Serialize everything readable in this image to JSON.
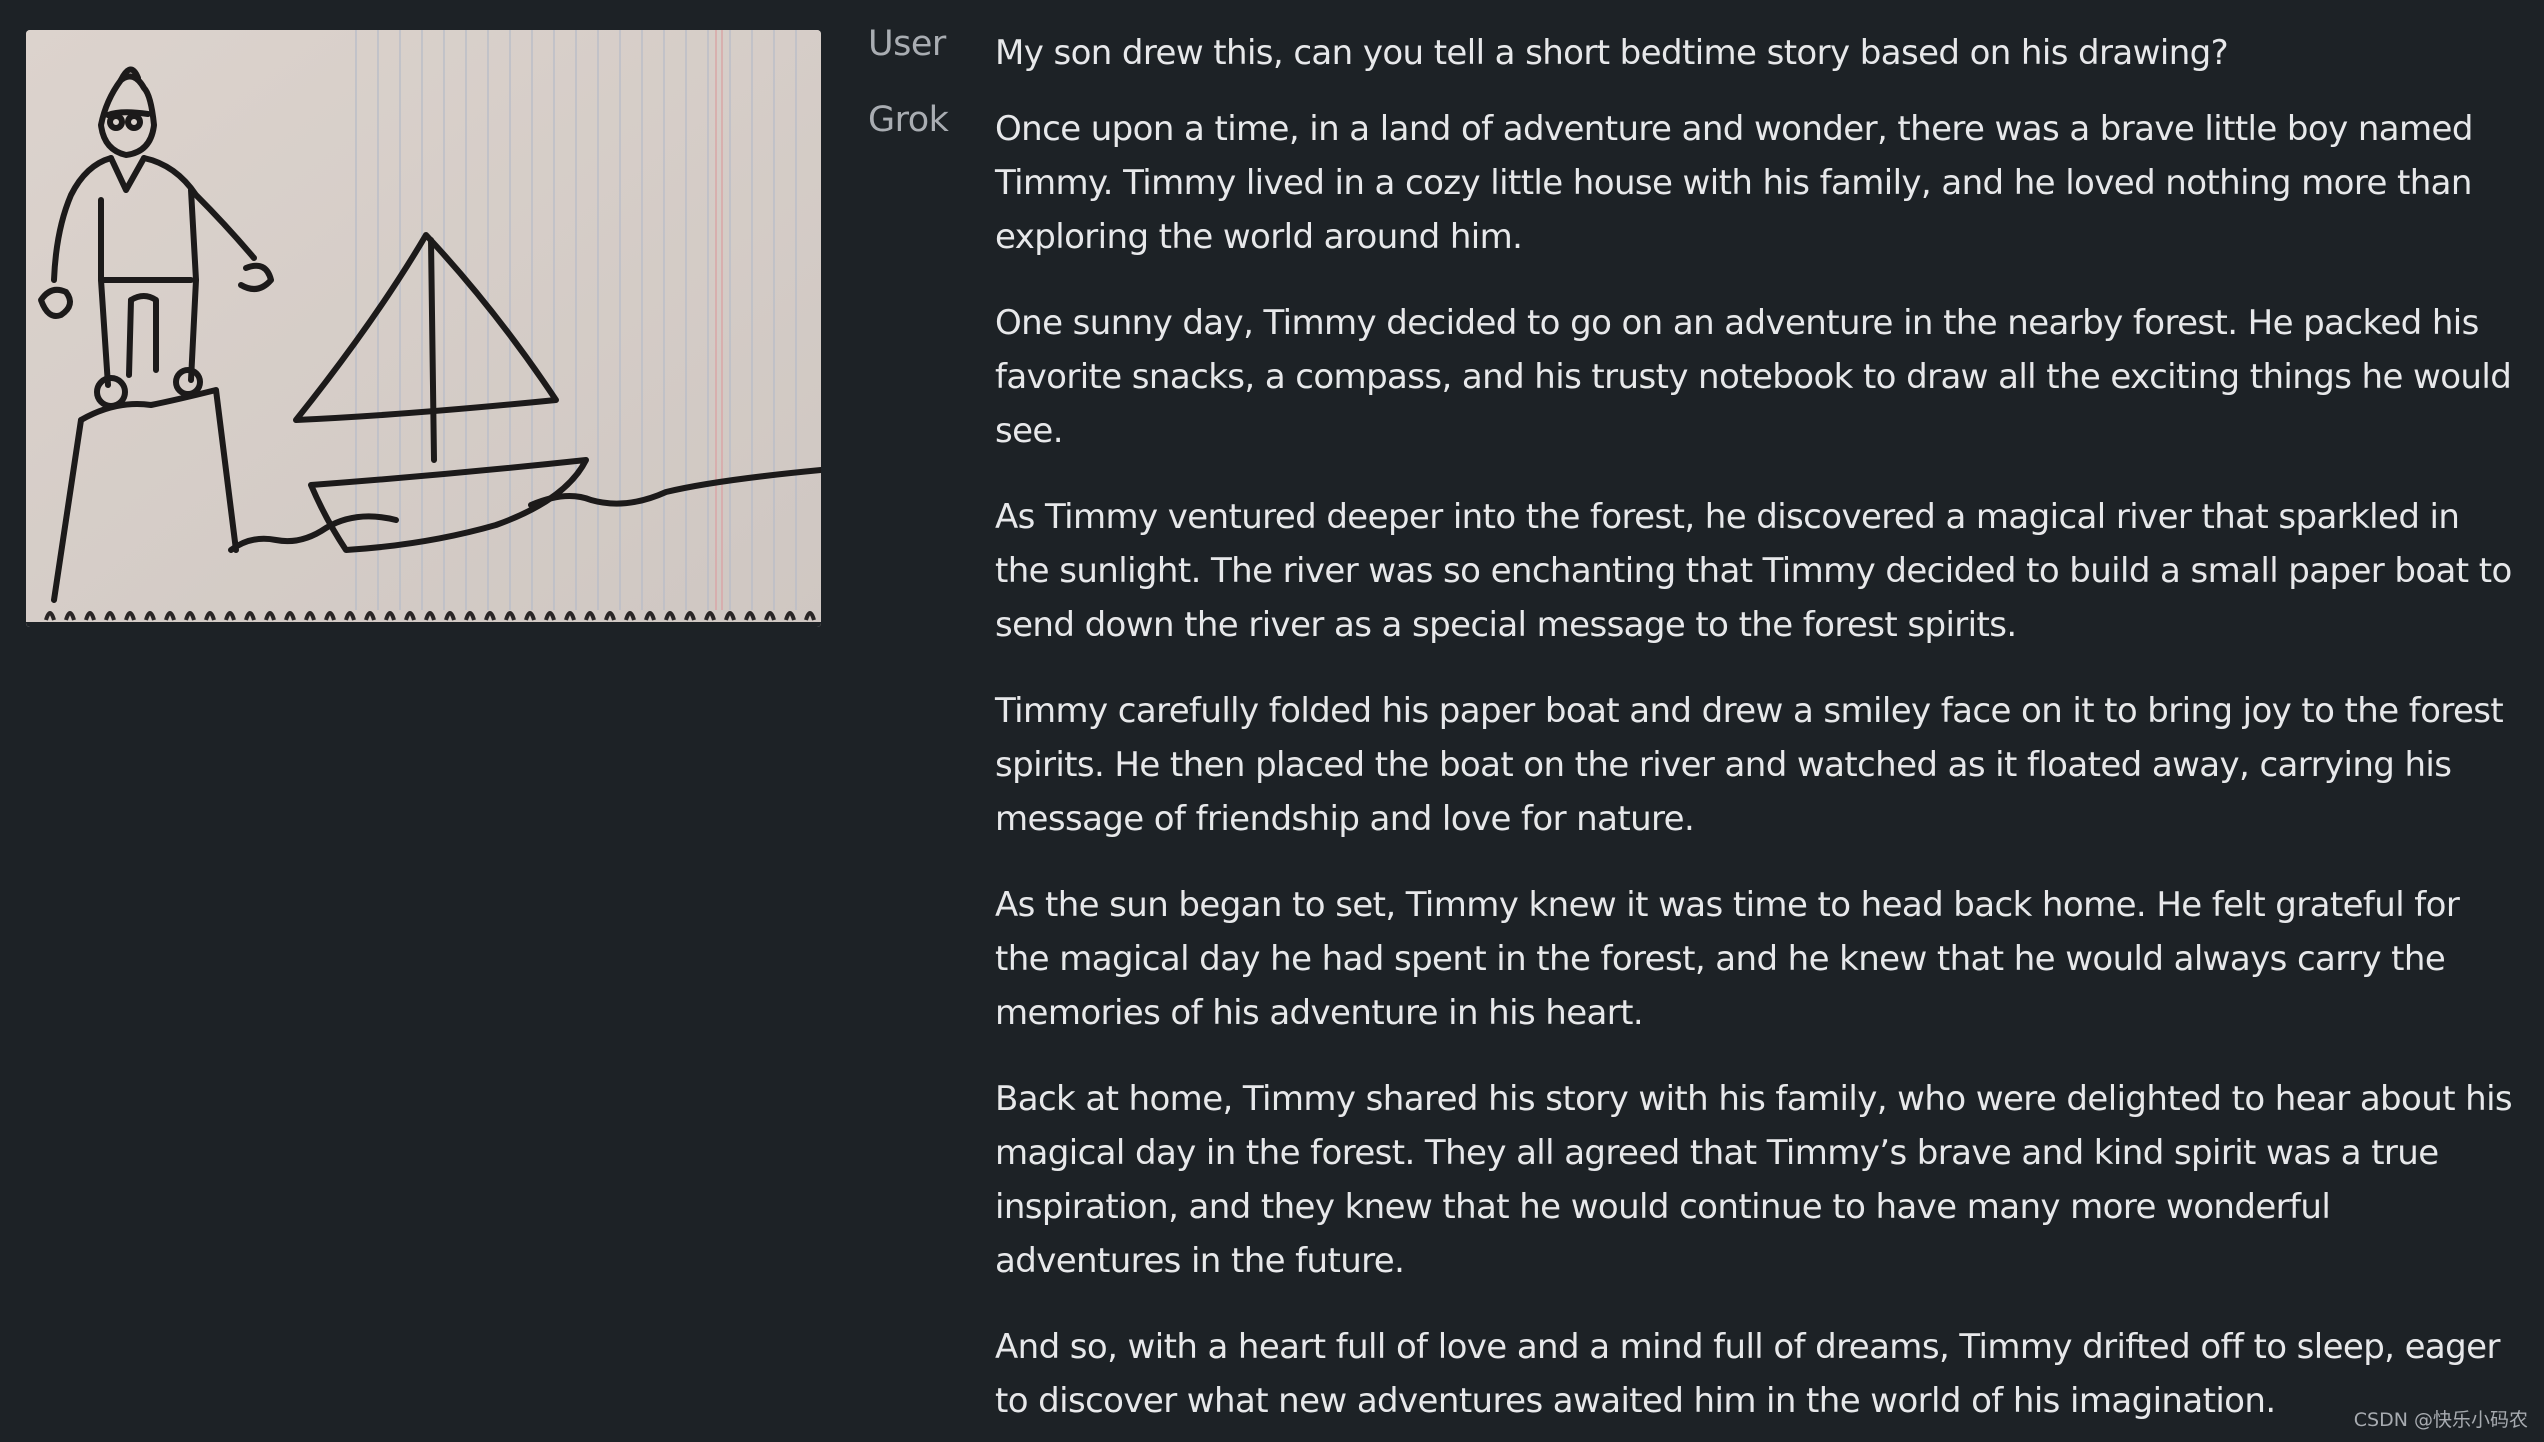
{
  "attachment": {
    "kind": "child-drawing-photo",
    "paper_color": "#d9d2cc",
    "ink_color": "#1c1a1a"
  },
  "conversation": {
    "user": {
      "speaker": "User",
      "message": "My son drew this, can you tell a short bedtime story based on his drawing?"
    },
    "grok": {
      "speaker": "Grok",
      "paragraphs": [
        "Once upon a time, in a land of adventure and wonder, there was a brave little boy named Timmy. Timmy lived in a cozy little house with his family, and he loved nothing more than exploring the world around him.",
        "One sunny day, Timmy decided to go on an adventure in the nearby forest. He packed his favorite snacks, a compass, and his trusty notebook to draw all the exciting things he would see.",
        "As Timmy ventured deeper into the forest, he discovered a magical river that sparkled in the sunlight. The river was so enchanting that Timmy decided to build a small paper boat to send down the river as a special message to the forest spirits.",
        "Timmy carefully folded his paper boat and drew a smiley face on it to bring joy to the forest spirits. He then placed the boat on the river and watched as it floated away, carrying his message of friendship and love for nature.",
        "As the sun began to set, Timmy knew it was time to head back home. He felt grateful for the magical day he had spent in the forest, and he knew that he would always carry the memories of his adventure in his heart.",
        "Back at home, Timmy shared his story with his family, who were delighted to hear about his magical day in the forest. They all agreed that Timmy’s brave and kind spirit was a true inspiration, and they knew that he would continue to have many more wonderful adventures in the future.",
        "And so, with a heart full of love and a mind full of dreams, Timmy drifted off to sleep, eager to discover what new adventures awaited him in the world of his imagination."
      ]
    }
  },
  "watermark": "CSDN @快乐小码农",
  "colors": {
    "background": "#1d2226",
    "text": "#e7e8ea",
    "speaker_label": "#a9adb2"
  }
}
